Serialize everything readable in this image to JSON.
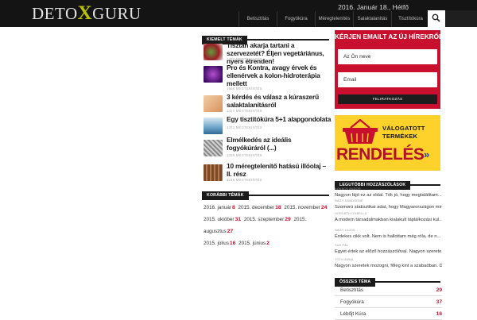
{
  "header": {
    "logo_pre": "DETO",
    "logo_x": "X",
    "logo_post": "GURU",
    "date": "2016. Január 18., Hétfő",
    "nav": [
      "Betisztítás",
      "Fogyókúra",
      "Méregtelenítés",
      "Salaktalanítás",
      "Tisztítókúra"
    ],
    "search_icon": "search-icon"
  },
  "featured": {
    "heading": "KIEMELT TÉMÁK",
    "items": [
      {
        "title": "Tisztán akarja tartani a szervezetét? Éljen vegetáriánus, nyers étrenden!",
        "meta": "1707 MEGTEKINTÉS"
      },
      {
        "title": "Pro és Kontra, avagy érvek és ellenérvek a kolon-hidroterápia mellett",
        "meta": "1666 MEGTEKINTÉS"
      },
      {
        "title": "3 kérdés és válasz a kúraszerű salaktalanításról",
        "meta": "1427 MEGTEKINTÉS"
      },
      {
        "title": "Egy tisztítókúra 5+1 alapgondolata",
        "meta": "1371 MEGTEKINTÉS"
      },
      {
        "title": "Elmélkedés az ideális fogyókúráról (...)",
        "meta": "1329 MEGTEKINTÉS"
      },
      {
        "title": "10 méregtelenítő hatású illóolaj – II. rész",
        "meta": "1236 MEGTEKINTÉS"
      }
    ]
  },
  "older": {
    "heading": "KORÁBBI TÉMÁK",
    "rows": [
      [
        {
          "m": "2016. január",
          "c": "8"
        },
        {
          "m": "2015. december",
          "c": "18"
        },
        {
          "m": "2015. november",
          "c": "24"
        }
      ],
      [
        {
          "m": "2015. október",
          "c": "31"
        },
        {
          "m": "2015. szeptember",
          "c": "29"
        },
        {
          "m": "2015. augusztus",
          "c": "27"
        }
      ],
      [
        {
          "m": "2015. július",
          "c": "16"
        },
        {
          "m": "2015. június",
          "c": "2"
        }
      ]
    ]
  },
  "newsletter": {
    "title": "KÉRJEN EMAILT AZ ÚJ HÍREKRŐL!",
    "name_placeholder": "Az Ön neve",
    "email_placeholder": "Email",
    "submit": "FELIRATKOZÁS",
    "color": "#c8102e"
  },
  "banner": {
    "line1": "VÁLOGATOTT",
    "line2": "TERMÉKEK",
    "order": "RENDELÉS",
    "arrows": "»"
  },
  "latest": {
    "heading": "LEGUTÓBBI HOZZÁSZÓLÁSOK",
    "items": [
      {
        "author": "KOVÁCS ANDOR",
        "text": "Nagyon fájó ez az oldal. Tök jó, hogy megtalálttam..."
      },
      {
        "author": "NAGY SÁNDORNÉ",
        "text": "Szomorú statisztikai adat, hogy Magyarországon mini..."
      },
      {
        "author": "HORVÁTH IZABELLA",
        "text": "A modern társadalmakban kialakult táplálkozási kul..."
      },
      {
        "author": "NAGY LAJOS",
        "text": "Érdekes cikk volt. Nem is hallottam még róla, de n..."
      },
      {
        "author": "SAS PÁL",
        "text": "Egyet értek az előző hozzászólóval. Nagyon szerete..."
      },
      {
        "author": "TÓTH ANNA",
        "text": "Nagyon szeretek mozogni, főleg kint a szabadban. D..."
      }
    ]
  },
  "all_topics": {
    "heading": "ÖSSZES TÉMA",
    "items": [
      {
        "name": "Betisztítás",
        "count": "29"
      },
      {
        "name": "Fogyókúra",
        "count": "37"
      },
      {
        "name": "Lébőjt Kúra",
        "count": "16"
      }
    ]
  }
}
